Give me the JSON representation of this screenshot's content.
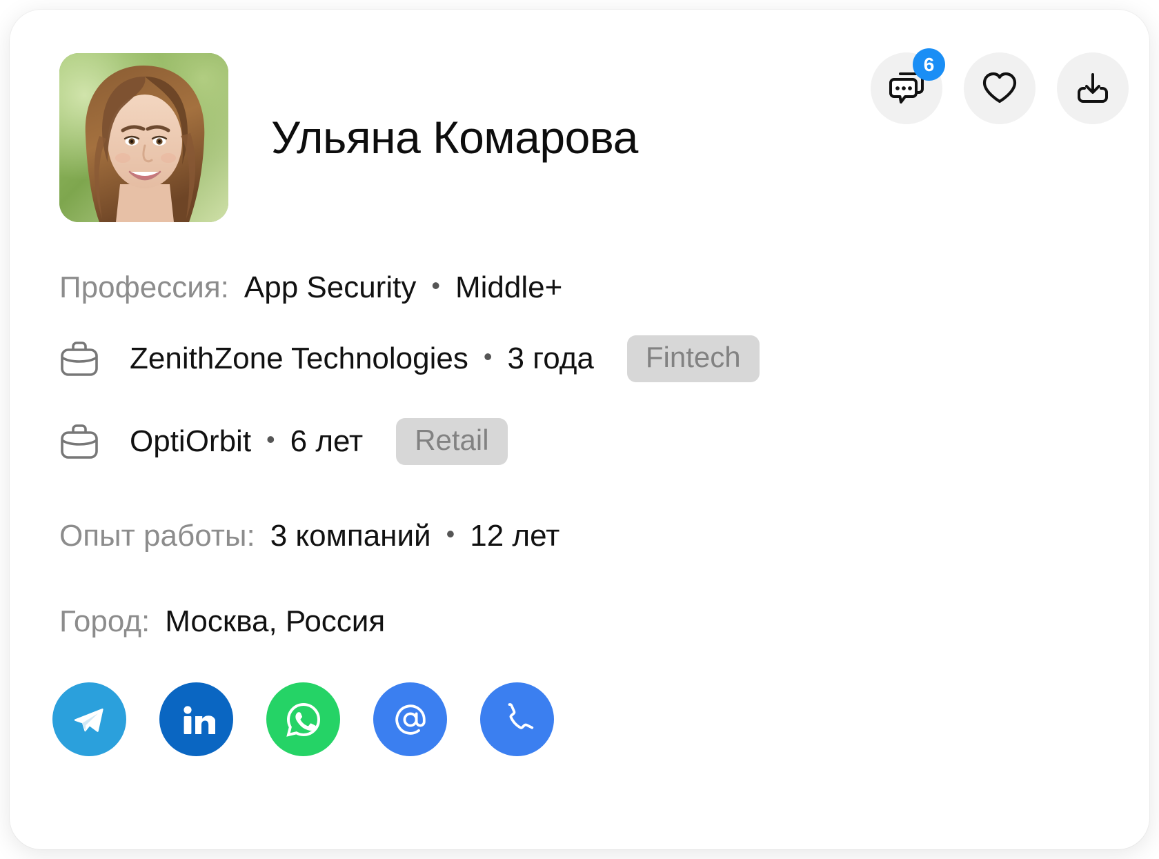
{
  "profile": {
    "name": "Ульяна Комарова",
    "avatar_alt": "avatar-photo"
  },
  "actions": [
    {
      "name": "messages-button",
      "icon": "chat-bubbles-icon",
      "badge": "6"
    },
    {
      "name": "favorite-button",
      "icon": "heart-icon",
      "badge": ""
    },
    {
      "name": "download-button",
      "icon": "download-icon",
      "badge": ""
    }
  ],
  "fields": {
    "profession_label": "Профессия:",
    "profession_value": "App Security",
    "profession_level": "Middle+",
    "experience_label": "Опыт работы:",
    "experience_companies": "3 компаний",
    "experience_years": "12 лет",
    "city_label": "Город:",
    "city_value": "Москва, Россия",
    "separator": "•"
  },
  "companies": [
    {
      "name": "ZenithZone Technologies",
      "duration": "3 года",
      "tag": "Fintech",
      "icon": "briefcase-icon"
    },
    {
      "name": "OptiOrbit",
      "duration": "6 лет",
      "tag": "Retail",
      "icon": "briefcase-icon"
    }
  ],
  "socials": [
    {
      "name": "telegram-link",
      "icon": "telegram-icon",
      "color": "#2BA0DC"
    },
    {
      "name": "linkedin-link",
      "icon": "linkedin-icon",
      "color": "#0A66C2"
    },
    {
      "name": "whatsapp-link",
      "icon": "whatsapp-icon",
      "color": "#25D366"
    },
    {
      "name": "email-link",
      "icon": "at-email-icon",
      "color": "#3B7FF0"
    },
    {
      "name": "phone-link",
      "icon": "phone-icon",
      "color": "#3B7FF0"
    }
  ],
  "colors": {
    "badge_blue": "#1A8EF5",
    "tag_bg": "#d7d7d7",
    "tag_text": "#828282",
    "label_gray": "#8c8c8c",
    "value_black": "#111111",
    "action_bg": "#f1f1f1"
  }
}
